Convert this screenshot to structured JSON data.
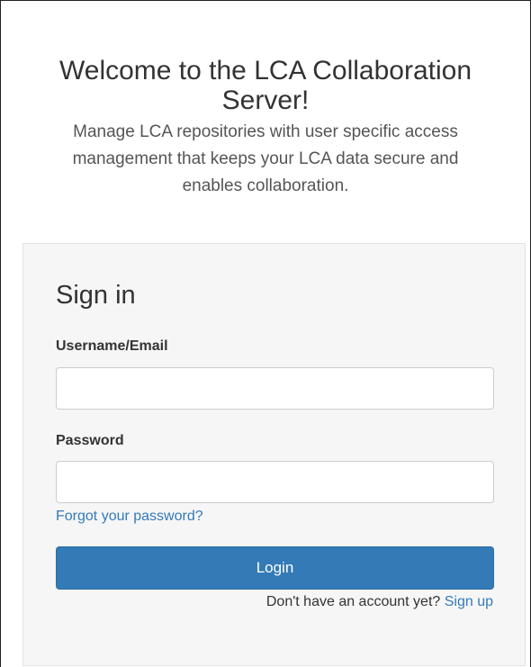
{
  "welcome": {
    "title": "Welcome to the LCA Collaboration Server!",
    "subtitle": "Manage LCA repositories with user specific access management that keeps your LCA data secure and enables collaboration."
  },
  "signin": {
    "title": "Sign in",
    "username_label": "Username/Email",
    "username_value": "",
    "password_label": "Password",
    "password_value": "",
    "forgot_link": "Forgot your password?",
    "login_button": "Login",
    "no_account_text": "Don't have an account yet?",
    "signup_link": "Sign up"
  },
  "colors": {
    "primary": "#337ab7",
    "card_background": "#f6f6f6"
  }
}
